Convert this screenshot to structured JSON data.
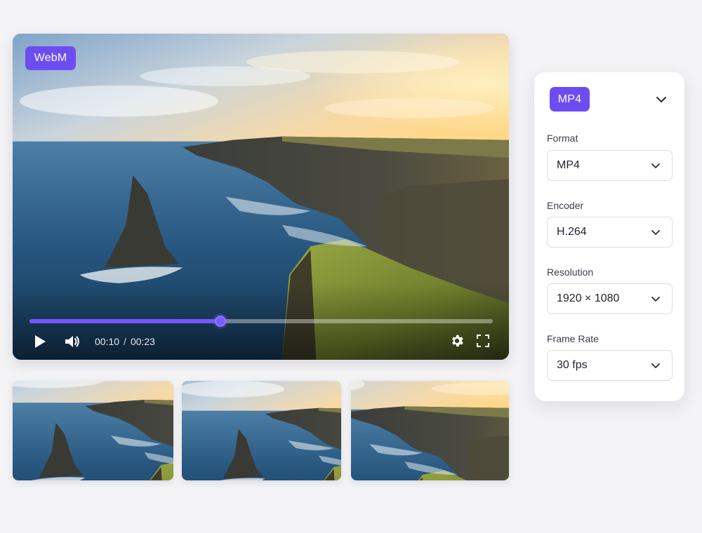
{
  "player": {
    "format_badge": "WebM",
    "current_time": "00:10",
    "separator": "/",
    "duration": "00:23",
    "progress": 0.412,
    "accent_color": "#6d4df2"
  },
  "icons": {
    "play": "play-icon",
    "volume": "volume-icon",
    "settings": "gear-icon",
    "fullscreen": "fullscreen-icon",
    "dropdown": "chevron-down-icon"
  },
  "thumbnails": [
    {
      "name": "thumbnail-1"
    },
    {
      "name": "thumbnail-2"
    },
    {
      "name": "thumbnail-3"
    }
  ],
  "panel": {
    "selected_badge": "MP4",
    "fields": [
      {
        "label": "Format",
        "value": "MP4"
      },
      {
        "label": "Encoder",
        "value": "H.264"
      },
      {
        "label": "Resolution",
        "value": "1920 × 1080"
      },
      {
        "label": "Frame Rate",
        "value": "30 fps"
      }
    ]
  }
}
